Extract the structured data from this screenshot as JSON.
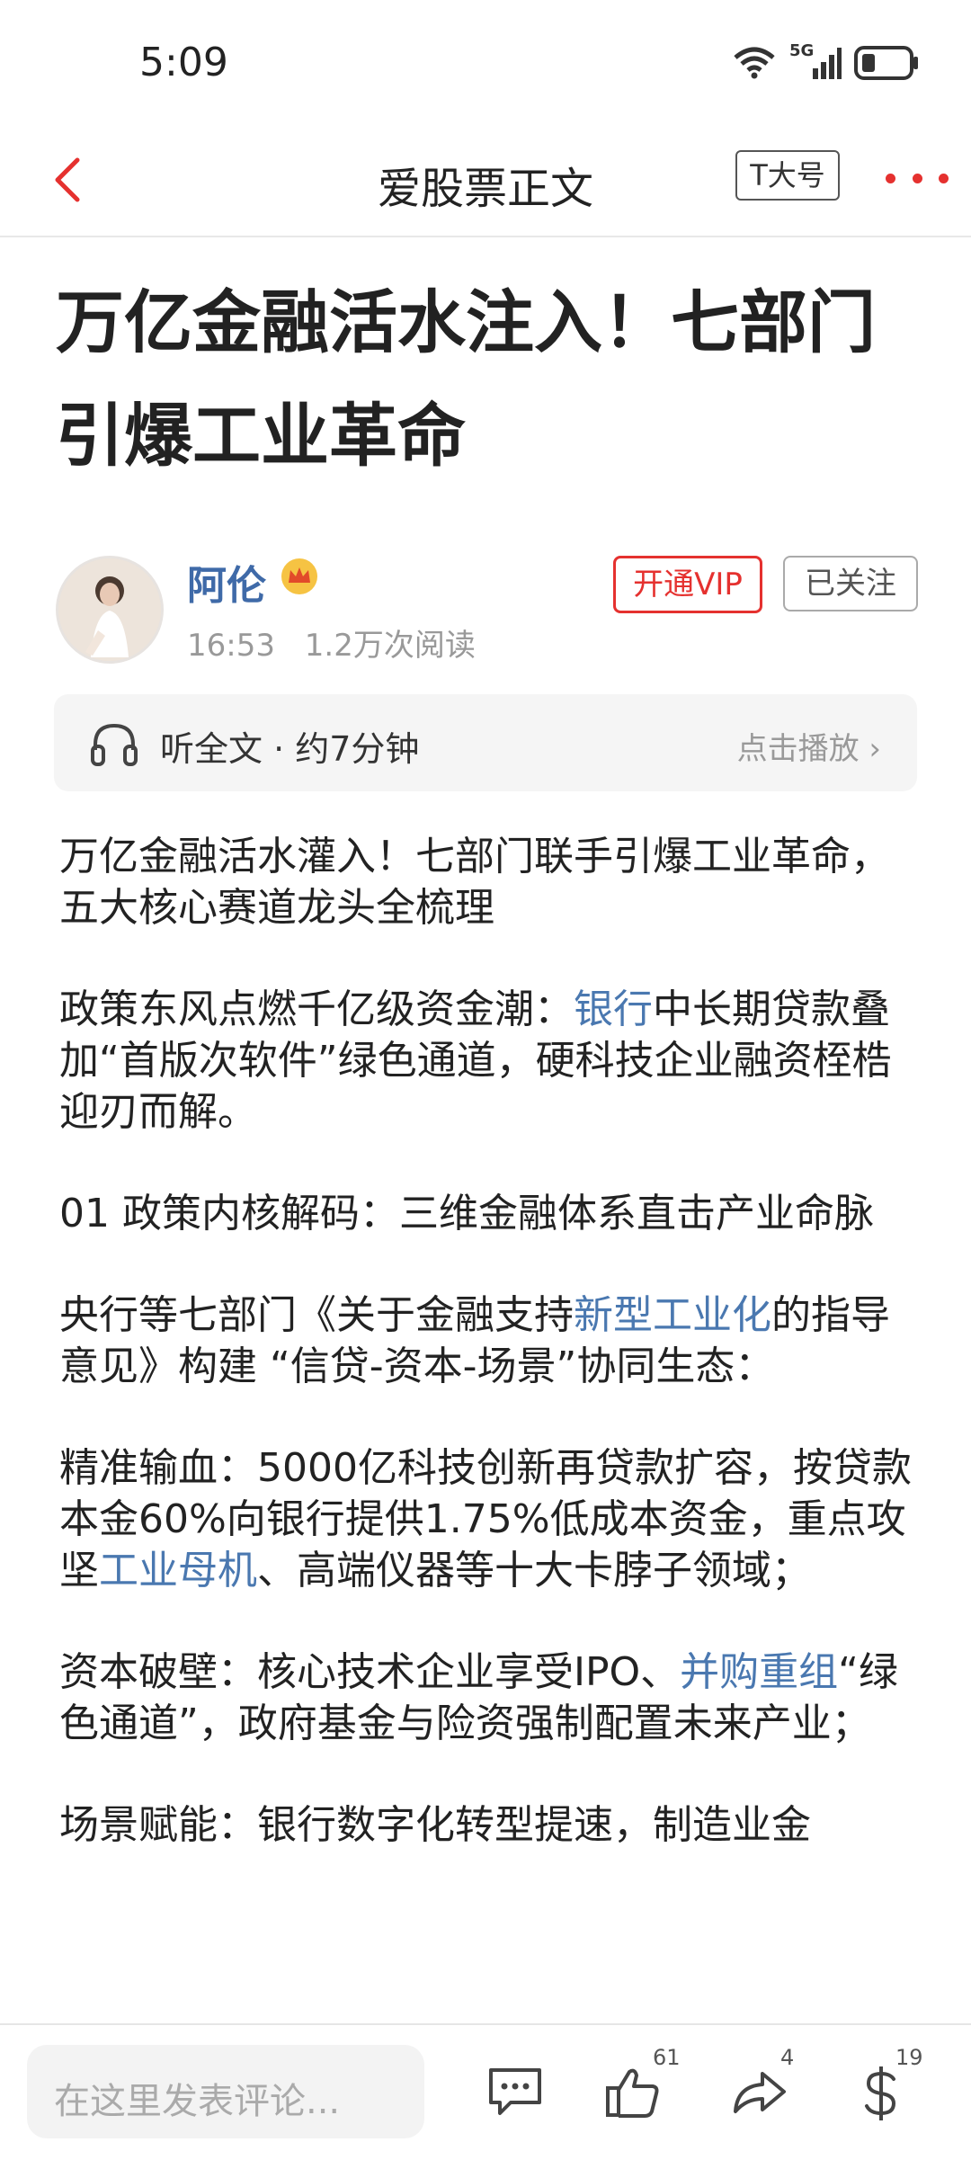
{
  "status_bar": {
    "time": "5:09",
    "network": "5G"
  },
  "navbar": {
    "title": "爱股票正文",
    "font_size_label": "T大号"
  },
  "article": {
    "title": "万亿金融活水注入！七部门引爆工业革命",
    "author": {
      "name": "阿伦",
      "time": "16:53",
      "reads": "1.2万次阅读"
    },
    "vip_label": "开通VIP",
    "follow_label": "已关注",
    "audio": {
      "label": "听全文 · 约7分钟",
      "action": "点击播放 ›"
    },
    "paragraphs": [
      "万亿金融活水灌入！七部门联手引爆工业革命，五大核心赛道龙头全梳理",
      "政策东风点燃千亿级资金潮：",
      "银行",
      "中长期贷款叠加“首版次软件”绿色通道，硬科技企业融资桎梏迎刃而解。",
      "01 政策内核解码：三维金融体系直击产业命脉",
      "央行等七部门《关于金融支持",
      "新型工业化",
      "的指导意见》构建 “信贷-资本-场景”协同生态：",
      "精准输血：5000亿科技创新再贷款扩容，按贷款本金60%向银行提供1.75%低成本资金，重点攻坚",
      "工业母机",
      "、高端仪器等十大卡脖子领域；",
      "资本破壁：核心技术企业享受IPO、",
      "并购重组",
      "“绿色通道”，政府基金与险资强制配置未来产业；",
      "场景赋能：银行数字化转型提速，制造业金"
    ]
  },
  "bottom_bar": {
    "comment_placeholder": "在这里发表评论...",
    "like_count": "61",
    "share_count": "4",
    "reward_count": "19"
  },
  "colors": {
    "accent_red": "#e5312f",
    "link_blue": "#4a78b0",
    "author_blue": "#3f6aa8"
  }
}
